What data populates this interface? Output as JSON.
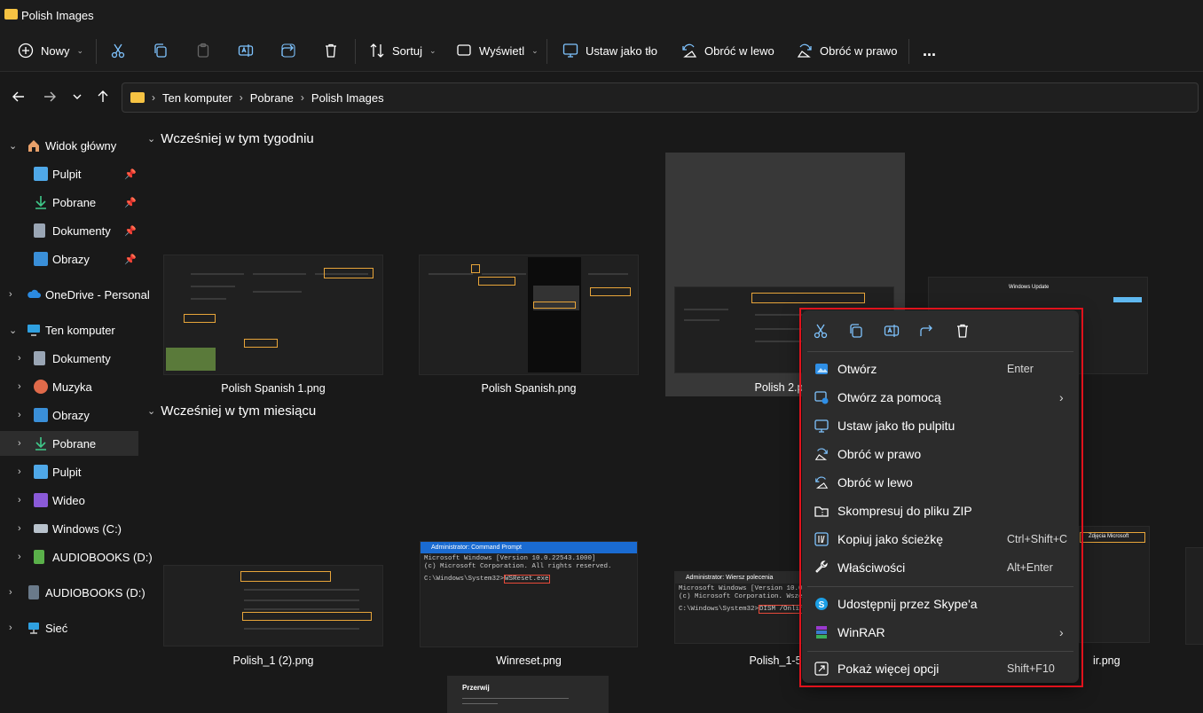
{
  "window": {
    "title": "Polish Images"
  },
  "toolbar": {
    "new_label": "Nowy",
    "sort_label": "Sortuj",
    "view_label": "Wyświetl",
    "set_bg_label": "Ustaw jako tło",
    "rotate_left_label": "Obróć w lewo",
    "rotate_right_label": "Obróć w prawo",
    "more_label": "..."
  },
  "address": {
    "crumbs": [
      "Ten komputer",
      "Pobrane",
      "Polish Images"
    ]
  },
  "sidebar": {
    "items": [
      {
        "label": "Widok główny",
        "icon": "home-icon"
      },
      {
        "label": "Pulpit",
        "icon": "desktop-icon",
        "pinned": true
      },
      {
        "label": "Pobrane",
        "icon": "download-icon",
        "pinned": true
      },
      {
        "label": "Dokumenty",
        "icon": "document-icon",
        "pinned": true
      },
      {
        "label": "Obrazy",
        "icon": "pictures-icon",
        "pinned": true
      },
      {
        "label": "OneDrive - Personal",
        "icon": "cloud-icon"
      },
      {
        "label": "Ten komputer",
        "icon": "computer-icon"
      },
      {
        "label": "Dokumenty",
        "icon": "document-icon"
      },
      {
        "label": "Muzyka",
        "icon": "music-icon"
      },
      {
        "label": "Obrazy",
        "icon": "pictures-icon"
      },
      {
        "label": "Pobrane",
        "icon": "download-icon"
      },
      {
        "label": "Pulpit",
        "icon": "desktop-icon"
      },
      {
        "label": "Wideo",
        "icon": "video-icon"
      },
      {
        "label": "Windows (C:)",
        "icon": "drive-icon"
      },
      {
        "label": "AUDIOBOOKS (D:)",
        "icon": "usb-drive-icon"
      },
      {
        "label": "AUDIOBOOKS (D:)",
        "icon": "usb-drive-icon"
      },
      {
        "label": "Sieć",
        "icon": "network-icon"
      }
    ]
  },
  "groups": [
    {
      "title": "Wcześniej w tym tygodniu"
    },
    {
      "title": "Wcześniej w tym miesiącu"
    }
  ],
  "files": {
    "week": [
      "Polish Spanish 1.png",
      "Polish Spanish.png",
      "Polish 2.p"
    ],
    "month": [
      "Polish_1 (2).png",
      "Winreset.png",
      "Polish_1-5",
      "ir.png"
    ]
  },
  "thumb_text": {
    "cmd_title_1": "Administrator: Command Prompt",
    "cmd_line_1a": "Microsoft Windows [Version 10.0.22543.1000]",
    "cmd_line_1b": "(c) Microsoft Corporation. All rights reserved.",
    "cmd_prompt_1": "C:\\Windows\\System32>",
    "cmd_cmd_1": "WSReset.exe",
    "cmd_title_2": "Administrator: Wiersz polecenia",
    "cmd_line_2a": "Microsoft Windows [Version 10.0.22581.200]",
    "cmd_line_2b": "(c) Microsoft Corporation. Wszelkie prawa",
    "cmd_prompt_2": "C:\\Windows\\System32>",
    "cmd_cmd_2": "DISM /Online /Cleanup",
    "wu_title": "Windows Update",
    "panel_title": "Przerwij",
    "right_thumb_text": "Zdjęcia Microsoft"
  },
  "context_menu": {
    "top_icons": [
      "cut-icon",
      "copy-icon",
      "rename-icon",
      "share-icon",
      "delete-icon"
    ],
    "items": [
      {
        "label": "Otwórz",
        "shortcut": "Enter",
        "icon": "photos-icon"
      },
      {
        "label": "Otwórz za pomocą",
        "submenu": true,
        "icon": "open-with-icon"
      },
      {
        "label": "Ustaw jako tło pulpitu",
        "icon": "wallpaper-icon"
      },
      {
        "label": "Obróć w prawo",
        "icon": "rotate-right-icon"
      },
      {
        "label": "Obróć w lewo",
        "icon": "rotate-left-icon"
      },
      {
        "label": "Skompresuj do pliku ZIP",
        "icon": "zip-icon"
      },
      {
        "label": "Kopiuj jako ścieżkę",
        "shortcut": "Ctrl+Shift+C",
        "icon": "copy-path-icon"
      },
      {
        "label": "Właściwości",
        "shortcut": "Alt+Enter",
        "icon": "properties-icon"
      },
      {
        "label": "Udostępnij przez Skype'a",
        "icon": "skype-icon"
      },
      {
        "label": "WinRAR",
        "submenu": true,
        "icon": "winrar-icon"
      },
      {
        "label": "Pokaż więcej opcji",
        "shortcut": "Shift+F10",
        "icon": "more-options-icon"
      }
    ],
    "submenu_glyph": "›"
  },
  "colors": {
    "accent": "#0078d4",
    "highlight_border": "#e0121c",
    "folder": "#f6c343"
  }
}
